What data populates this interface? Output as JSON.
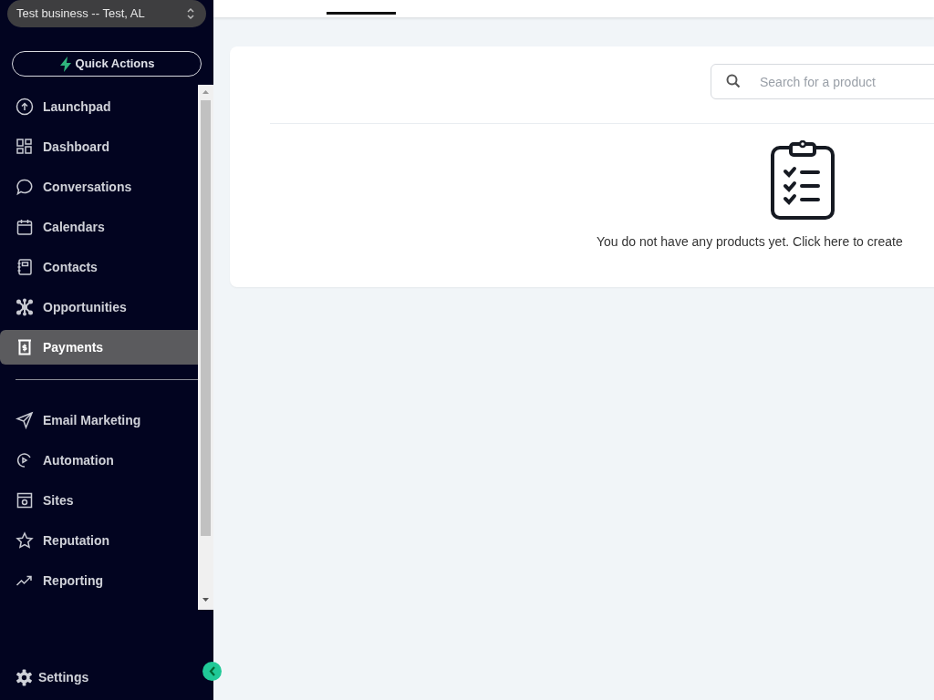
{
  "account_switcher": {
    "label": "Test business -- Test, AL"
  },
  "quick_actions": {
    "label": "Quick Actions"
  },
  "nav": {
    "primary": [
      {
        "label": "Launchpad",
        "selected": false
      },
      {
        "label": "Dashboard",
        "selected": false
      },
      {
        "label": "Conversations",
        "selected": false
      },
      {
        "label": "Calendars",
        "selected": false
      },
      {
        "label": "Contacts",
        "selected": false
      },
      {
        "label": "Opportunities",
        "selected": false
      },
      {
        "label": "Payments",
        "selected": true
      }
    ],
    "secondary": [
      {
        "label": "Email Marketing",
        "selected": false
      },
      {
        "label": "Automation",
        "selected": false
      },
      {
        "label": "Sites",
        "selected": false
      },
      {
        "label": "Reputation",
        "selected": false
      },
      {
        "label": "Reporting",
        "selected": false
      }
    ]
  },
  "settings": {
    "label": "Settings"
  },
  "products": {
    "search": {
      "placeholder": "Search for a product"
    },
    "empty_message": "You do not have any products yet. Click here to create"
  }
}
